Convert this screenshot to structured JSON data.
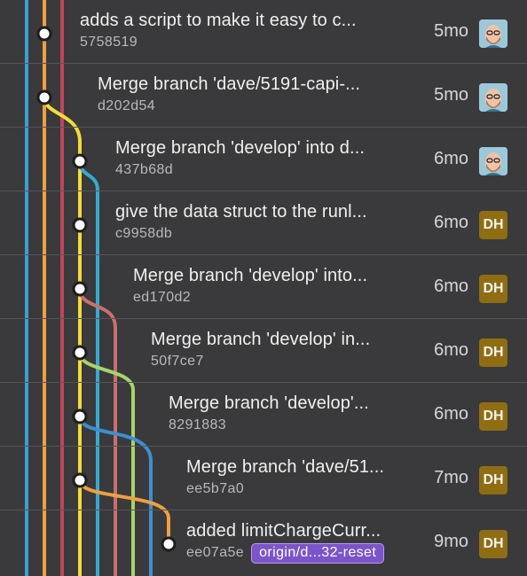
{
  "colors": {
    "lane_blue": "#3a9fd6",
    "lane_orange": "#f0a040",
    "lane_red": "#c0455a",
    "lane_yellow": "#f2dc3a",
    "lane_teal": "#39a9cf",
    "lane_rose": "#c8706e",
    "lane_green": "#a8d46a",
    "lane_branch_blue": "#3d8fd0",
    "lane_branch_orange": "#f0a040",
    "badge_bg": "#7b55c8",
    "initials_bg": "#8f6d12"
  },
  "commits": [
    {
      "message": "adds a script to make it easy to c...",
      "sha": "5758519",
      "time": "5mo",
      "author": "avatar-photo"
    },
    {
      "message": "Merge branch 'dave/5191-capi-...",
      "sha": "d202d54",
      "time": "5mo",
      "author": "avatar-photo"
    },
    {
      "message": "Merge branch 'develop' into d...",
      "sha": "437b68d",
      "time": "6mo",
      "author": "avatar-photo"
    },
    {
      "message": "give the data struct to the runl...",
      "sha": "c9958db",
      "time": "6mo",
      "author": "DH"
    },
    {
      "message": "Merge branch 'develop' into...",
      "sha": "ed170d2",
      "time": "6mo",
      "author": "DH"
    },
    {
      "message": "Merge branch 'develop' in...",
      "sha": "50f7ce7",
      "time": "6mo",
      "author": "DH"
    },
    {
      "message": "Merge branch 'develop'...",
      "sha": "8291883",
      "time": "6mo",
      "author": "DH"
    },
    {
      "message": "Merge branch 'dave/51...",
      "sha": "ee5b7a0",
      "time": "7mo",
      "author": "DH"
    },
    {
      "message": "added limitChargeCurr...",
      "sha": "ee07a5e",
      "time": "9mo",
      "author": "DH",
      "badge": "origin/d...32-reset"
    }
  ]
}
